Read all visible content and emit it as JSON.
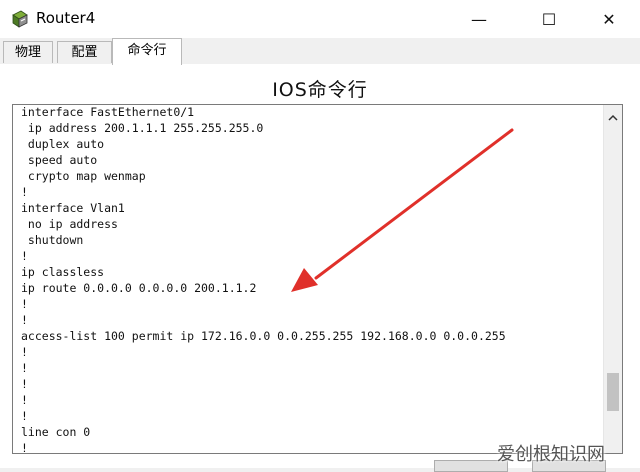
{
  "window": {
    "title": "Router4",
    "minimize_glyph": "—",
    "maximize_glyph": "☐",
    "close_glyph": "✕"
  },
  "tabs": [
    {
      "label": "物理"
    },
    {
      "label": "配置"
    },
    {
      "label": "命令行",
      "active": true
    }
  ],
  "page": {
    "heading": "IOS命令行"
  },
  "console": {
    "lines": [
      "interface FastEthernet0/1",
      " ip address 200.1.1.1 255.255.255.0",
      " duplex auto",
      " speed auto",
      " crypto map wenmap",
      "!",
      "interface Vlan1",
      " no ip address",
      " shutdown",
      "!",
      "ip classless",
      "ip route 0.0.0.0 0.0.0.0 200.1.1.2",
      "!",
      "!",
      "access-list 100 permit ip 172.16.0.0 0.0.255.255 192.168.0.0 0.0.0.255",
      "!",
      "!",
      "!",
      "!",
      "!",
      "line con 0",
      "!"
    ],
    "scroll_position": 0.8
  },
  "annotation": {
    "color": "#e0302a"
  },
  "watermark": "爱创根知识网",
  "icons": {
    "app": "router-app-icon",
    "scroll_up": "chevron-up-icon"
  }
}
